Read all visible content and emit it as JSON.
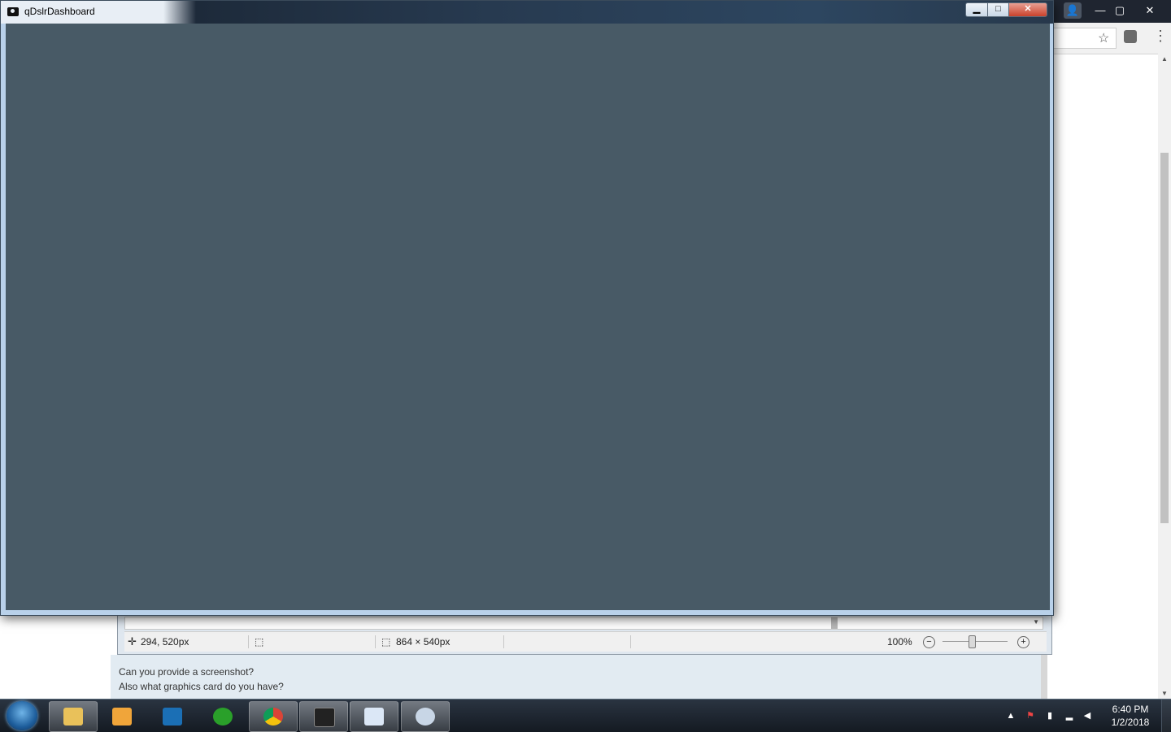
{
  "app_window": {
    "title": "qDslrDashboard",
    "controls": {
      "minimize": "▁",
      "maximize": "□",
      "close": "✕"
    },
    "content_color": "#485a66"
  },
  "browser": {
    "controls": {
      "profile": "👤",
      "minimize": "—",
      "maximize": "▢",
      "close": "✕"
    },
    "icons": [
      "star-icon",
      "extension-icon",
      "menu-icon"
    ]
  },
  "paint_window": {
    "cursor_position": "294, 520px",
    "image_size": "864 × 540px",
    "zoom": "100%",
    "icons": [
      "move-icon",
      "selection-icon",
      "image-size-icon",
      "zoom-out-icon",
      "zoom-in-icon"
    ]
  },
  "forum_post": {
    "line1": "Can you provide a screenshot?",
    "line2": "Also what graphics card do you have?"
  },
  "taskbar": {
    "items": [
      {
        "name": "Windows Explorer",
        "icon": "folder-icon",
        "active": true
      },
      {
        "name": "Media Player",
        "icon": "media-player-icon",
        "active": false
      },
      {
        "name": "TeamViewer",
        "icon": "teamviewer-icon",
        "active": false
      },
      {
        "name": "Green app",
        "icon": "green-circle-icon",
        "active": false
      },
      {
        "name": "Chrome",
        "icon": "chrome-icon",
        "active": true
      },
      {
        "name": "Camera",
        "icon": "camera-icon",
        "active": true
      },
      {
        "name": "WordPad",
        "icon": "wordpad-icon",
        "active": true
      },
      {
        "name": "Paint",
        "icon": "paint-icon",
        "active": true
      }
    ],
    "clock": {
      "time": "6:40 PM",
      "date": "1/2/2018"
    }
  }
}
